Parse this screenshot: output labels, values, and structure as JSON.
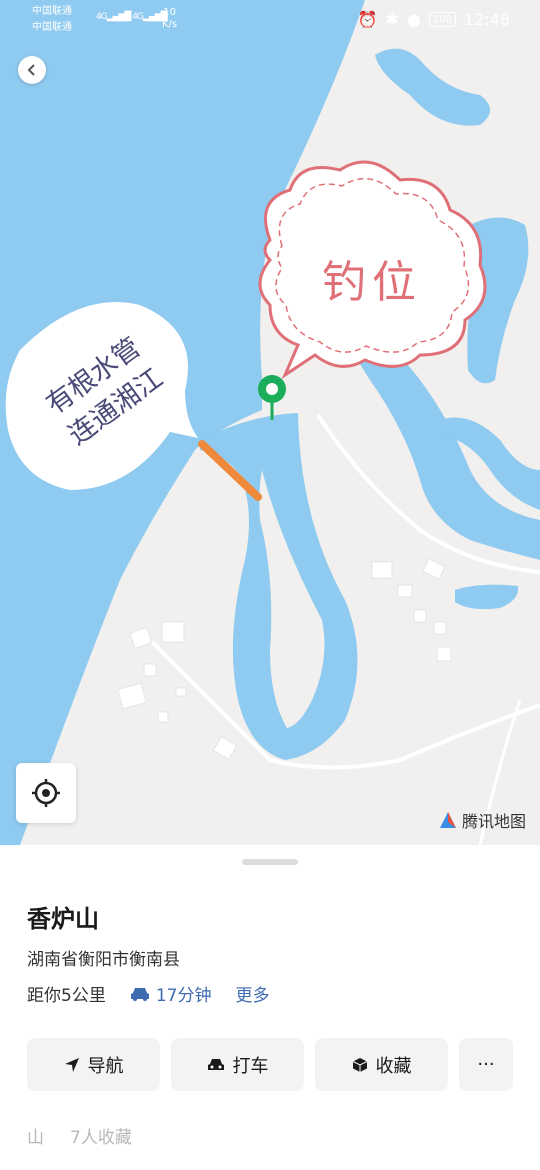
{
  "status_bar": {
    "carrier_1": "中国联通",
    "carrier_2": "中国联通",
    "net_speed_value": "10",
    "net_speed_unit": "K/s",
    "battery": "100",
    "time": "12:48"
  },
  "map": {
    "brand_label": "腾讯地图",
    "annotations": {
      "cloud_label": "钓位",
      "bubble_line_1": "有根水管",
      "bubble_line_2": "连通湘江"
    },
    "colors": {
      "water": "#8fcaf0",
      "land": "#f1f0ee",
      "pin": "#1aad5a",
      "pipe": "#ef8a3c",
      "cloud_stroke": "#e07078"
    }
  },
  "place": {
    "name": "香炉山",
    "address": "湖南省衡阳市衡南县",
    "distance": "距你5公里",
    "drive_time": "17分钟",
    "more_label": "更多"
  },
  "actions": {
    "navigate": "导航",
    "taxi": "打车",
    "favorite": "收藏",
    "more": "···"
  },
  "footer": {
    "type_icon_label": "山",
    "favorites_count": "7人收藏"
  }
}
